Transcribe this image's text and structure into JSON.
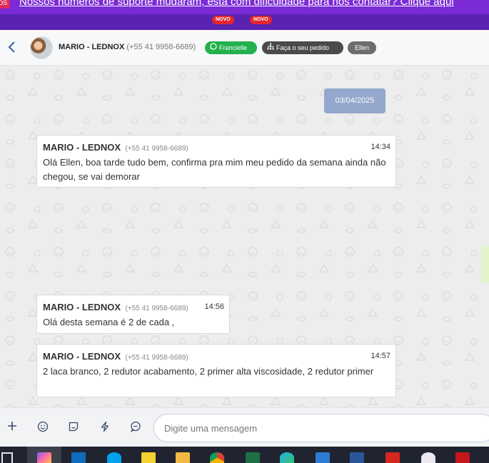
{
  "banner": {
    "icon_label": "DS",
    "text": "Nossos números de suporte mudaram, está com dificuldade para nos contatar? Clique aqui",
    "badges": [
      "NOVO",
      "NOVO"
    ],
    "colors": {
      "background": "#7a2bd6",
      "badge": "#e3262f"
    }
  },
  "header": {
    "back_icon": "chevron-left-icon",
    "contact_name": "MARIO - LEDNOX",
    "contact_phone": "(+55 41 9958-6689)",
    "tags": [
      {
        "label": "Francielle",
        "icon": "whatsapp-icon",
        "color": "#22b14c"
      },
      {
        "label": "Faça o seu pedido",
        "icon": "sitemap-icon",
        "color": "#4a4a4a"
      },
      {
        "label": "Ellen",
        "color": "#6d6d6d"
      }
    ]
  },
  "chat": {
    "date_chip": "03/04/2025",
    "messages": [
      {
        "sender": "MARIO - LEDNOX",
        "phone": "(+55 41 9958-6689)",
        "time": "14:34",
        "text": "Olá Ellen, boa tarde tudo bem, confirma pra mim meu pedido da semana ainda não chegou, se vai demorar"
      },
      {
        "sender": "MARIO - LEDNOX",
        "phone": "(+55 41 9958-6689)",
        "time": "14:56",
        "text": "Olá desta semana é 2 de cada ,"
      },
      {
        "sender": "MARIO - LEDNOX",
        "phone": "(+55 41 9958-6689)",
        "time": "14:57",
        "text": "2 laca branco, 2 redutor acabamento, 2 primer alta viscosidade, 2 redutor primer"
      }
    ]
  },
  "composer": {
    "placeholder": "Digite uma mensagem",
    "tools": [
      "plus-icon",
      "emoji-icon",
      "sticker-icon",
      "lightning-icon",
      "chat-bubble-icon"
    ]
  },
  "taskbar": {
    "apps": [
      "copilot",
      "outlook",
      "skype",
      "notes",
      "file-explorer",
      "chrome",
      "excel",
      "edge",
      "outlook-calendar",
      "word",
      "acrobat",
      "snipping-tool",
      "acrobat-reader"
    ]
  }
}
